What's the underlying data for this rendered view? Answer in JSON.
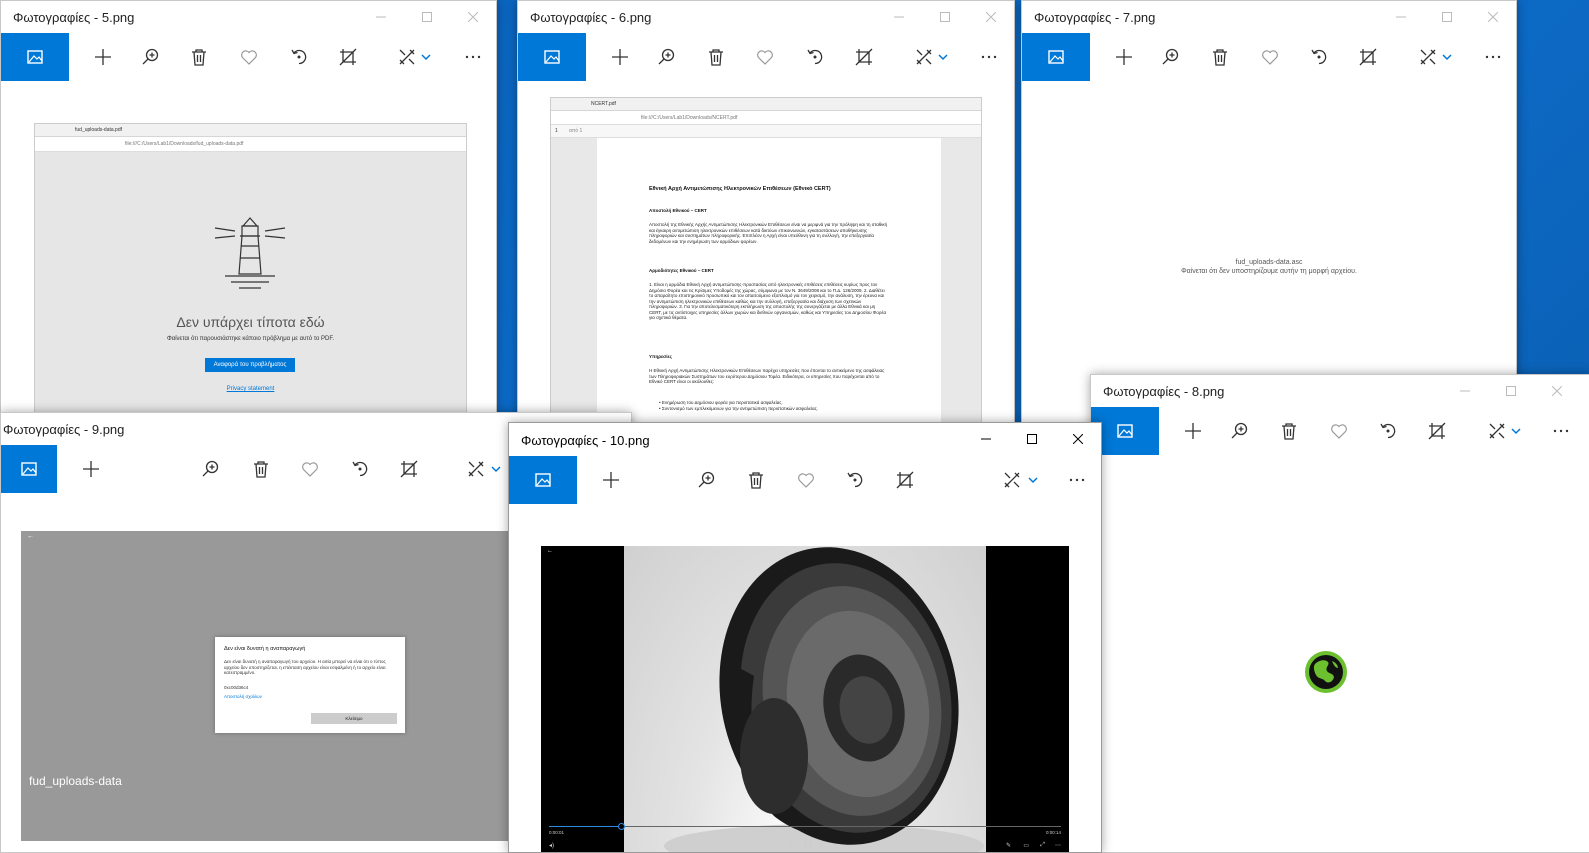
{
  "windows": {
    "w5": {
      "title": "Φωτογραφίες - 5.png"
    },
    "w6": {
      "title": "Φωτογραφίες - 6.png"
    },
    "w7": {
      "title": "Φωτογραφίες - 7.png"
    },
    "w8": {
      "title": "Φωτογραφίες - 8.png"
    },
    "w9": {
      "title": "Φωτογραφίες - 9.png"
    },
    "w10": {
      "title": "Φωτογραφίες - 10.png"
    }
  },
  "icons": [
    "photo-tile-icon",
    "add-icon",
    "zoom-in-icon",
    "delete-icon",
    "favorite-icon",
    "rotate-icon",
    "crop-icon",
    "edit-icon",
    "chevron-down-icon",
    "more-icon",
    "minimize-icon",
    "maximize-icon",
    "close-icon"
  ],
  "w5_content": {
    "tab_label": "fud_uploads-data.pdf",
    "address": "file:///C:/Users/Lab1/Downloads/fud_uploads-data.pdf",
    "heading": "Δεν υπάρχει τίποτα εδώ",
    "message": "Φαίνεται ότι παρουσιάστηκε κάποιο πρόβλημα με αυτό το PDF.",
    "report_button": "Αναφορά του προβλήματος",
    "privacy_link": "Privacy statement"
  },
  "w6_content": {
    "tab_label": "NCERT.pdf",
    "address": "file:///C:/Users/Lab1/Downloads/NCERT.pdf",
    "page_num": "1",
    "page_of": "από 1",
    "doc_title": "Εθνική Αρχή Αντιμετώπισης Ηλεκτρονικών Επιθέσεων (Εθνικό CERT)",
    "section1": "Αποστολή Εθνικού – CERT",
    "para1": "Αποστολή της Εθνικής Αρχής Αντιμετώπισης Ηλεκτρονικών Επιθέσεων είναι να μεριμνά για την πρόληψη και τη σταθική και έγκαιρη αντιμετώπιση ηλεκτρονικών επιθέσεων κατά δικτύων επικοινωνιών, εγκαταστάσεων αποθήκευσης πληροφοριών και συστημάτων πληροφορικής. Επιπλέον η Αρχή είναι υπεύθυνη για τη συλλογή, την επεξεργασία δεδομένων και την ενημέρωση των αρμόδιων φορέων.",
    "section2": "Αρμοδιότητες Εθνικού – CERT",
    "para2": "1. Είναι η αρμόδια Εθνική Αρχή αντιμετώπισης-προστασίας από ηλεκτρονικές επιθέσεις επιθέσεις κυρίως προς τον Δημόσιο Φορέα και τις Κρίσιμες Υποδομές της χώρας, σύμφωνα με τον Ν. 3649/2008 και το Π.Δ. 126/2009. 2. Διαθέτει το απαραίτητο επιστημονικό προσωπικό και τον απαιτούμενο εξοπλισμό για τον χειρισμό, την ανάλυση, την έρευνα και την αντιμετώπιση ηλεκτρονικών επιθέσεων καθώς και την συλλογή, επεξεργασία και διάχυση των σχετικών πληροφοριών. 3. Για την αποτελεσματικότερη εκπλήρωση της αποστολής της συνεργάζεται με άλλα Εθνικά και μη CERT, με τις αντίστοιχες υπηρεσίες άλλων χωρών και διεθνών οργανισμών, καθώς και Υπηρεσίες του Δημοσίου Φορέα για σχετικά θέματα.",
    "section3": "Υπηρεσίες",
    "para3": "Η Εθνική Αρχή Αντιμετώπισης Ηλεκτρονικών Επιθέσεων παρέχει υπηρεσίες που έπονται το αντικείμενο της ασφάλειας των Πληροφοριακών Συστημάτων του ευρύτερου Δημόσιου Τομέα. Ειδικότερα, οι υπηρεσίες που παρέχονται από το Εθνικό CERT είναι οι ακόλουθες:",
    "bullet1": "Ενημέρωση του Δημόσιου φορέα για περιστατικά ασφαλείας.",
    "bullet2": "Συντονισμό των εμπλεκόμενων για την αντιμετώπιση περιστατικών ασφαλείας."
  },
  "w7_content": {
    "filename": "fud_uploads-data.asc",
    "message": "Φαίνεται ότι δεν υποστηρίζουμε αυτήν τη μορφή αρχείου."
  },
  "w9_content": {
    "dialog_title": "Δεν είναι δυνατή η αναπαραγωγή",
    "dialog_body": "Δεν είναι δυνατή η αναπαραγωγή του αρχείου. Η αιτία μπορεί να είναι ότι ο τύπος αρχείου δεν υποστηρίζεται, η επέκταση αρχείου είναι εσφαλμένη ή το αρχείο είναι κατεστραμμένο.",
    "error_code": "0xc00d36c4",
    "send_feedback": "Αποστολή σχολίων",
    "close_button": "Κλείσιμο",
    "file_label": "fud_uploads-data"
  },
  "w10_content": {
    "time_elapsed": "0:00:01",
    "time_total": "0:00:14",
    "progress": 0.14
  }
}
